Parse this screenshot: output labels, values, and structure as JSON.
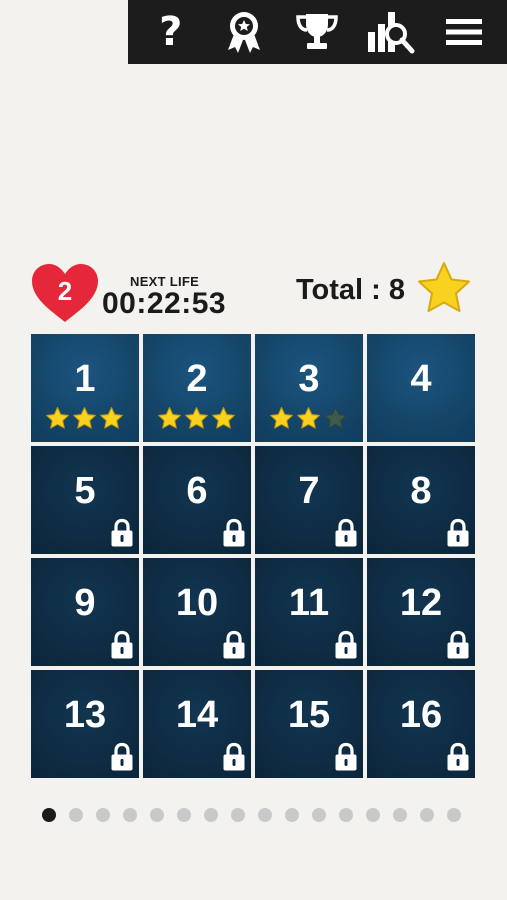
{
  "toolbar": {
    "buttons": [
      {
        "name": "help-button",
        "icon": "question-mark-icon"
      },
      {
        "name": "achievements-button",
        "icon": "ribbon-badge-icon"
      },
      {
        "name": "trophy-button",
        "icon": "trophy-icon"
      },
      {
        "name": "leaderboard-button",
        "icon": "stats-search-icon"
      },
      {
        "name": "menu-button",
        "icon": "hamburger-menu-icon"
      }
    ],
    "help_label": "?"
  },
  "status": {
    "lives": "2",
    "next_life_label": "NEXT LIFE",
    "timer": "00:22:53",
    "total_label": "Total : 8"
  },
  "levels": [
    {
      "label": "1",
      "locked": false,
      "stars": 3
    },
    {
      "label": "2",
      "locked": false,
      "stars": 3
    },
    {
      "label": "3",
      "locked": false,
      "stars": 2
    },
    {
      "label": "4",
      "locked": false,
      "stars": 0
    },
    {
      "label": "5",
      "locked": true,
      "stars": 0
    },
    {
      "label": "6",
      "locked": true,
      "stars": 0
    },
    {
      "label": "7",
      "locked": true,
      "stars": 0
    },
    {
      "label": "8",
      "locked": true,
      "stars": 0
    },
    {
      "label": "9",
      "locked": true,
      "stars": 0
    },
    {
      "label": "10",
      "locked": true,
      "stars": 0
    },
    {
      "label": "11",
      "locked": true,
      "stars": 0
    },
    {
      "label": "12",
      "locked": true,
      "stars": 0
    },
    {
      "label": "13",
      "locked": true,
      "stars": 0
    },
    {
      "label": "14",
      "locked": true,
      "stars": 0
    },
    {
      "label": "15",
      "locked": true,
      "stars": 0
    },
    {
      "label": "16",
      "locked": true,
      "stars": 0
    }
  ],
  "pagination": {
    "pages": 16,
    "current": 1
  },
  "colors": {
    "heart": "#e5273a",
    "star": "#f7d21e",
    "star_empty": "#3e5a4b",
    "tile_unlocked": "#144568",
    "tile_locked": "#0d2a41",
    "toolbar": "#1c1c1c",
    "background": "#f3f2ee"
  }
}
